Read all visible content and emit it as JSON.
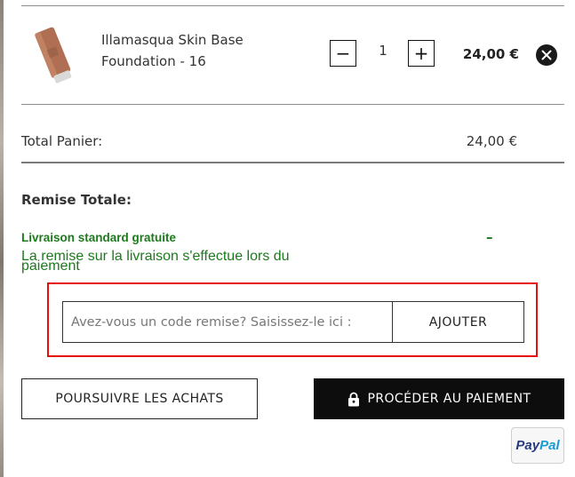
{
  "cart": {
    "item": {
      "name_line1": "Illamasqua Skin Base",
      "name_line2": "Foundation - 16",
      "quantity": "1",
      "qty_minus": "−",
      "qty_plus": "+",
      "price": "24,00 €",
      "image_icon": "foundation-bottle-icon",
      "remove_icon": "close-icon"
    },
    "total_label": "Total Panier:",
    "total_value": "24,00 €"
  },
  "discounts": {
    "title": "Remise Totale:",
    "free_shipping_label": "Livraison standard gratuite",
    "free_shipping_value": "–",
    "note": "La remise sur la livraison s'effectue lors du paiement"
  },
  "promo": {
    "placeholder": "Avez-vous un code remise? Saisissez-le ici :",
    "button_label": "AJOUTER",
    "highlight_color": "#e60d0d"
  },
  "actions": {
    "continue_label": "POURSUIVRE LES ACHATS",
    "checkout_label": "PROCÉDER AU PAIEMENT",
    "checkout_icon": "lock-icon",
    "paypal_part1": "Pay",
    "paypal_part2": "Pal"
  },
  "colors": {
    "accent_green": "#1d7a1d",
    "primary_dark": "#0d0d0d",
    "paypal_dark_blue": "#253b80",
    "paypal_light_blue": "#179bd7"
  }
}
